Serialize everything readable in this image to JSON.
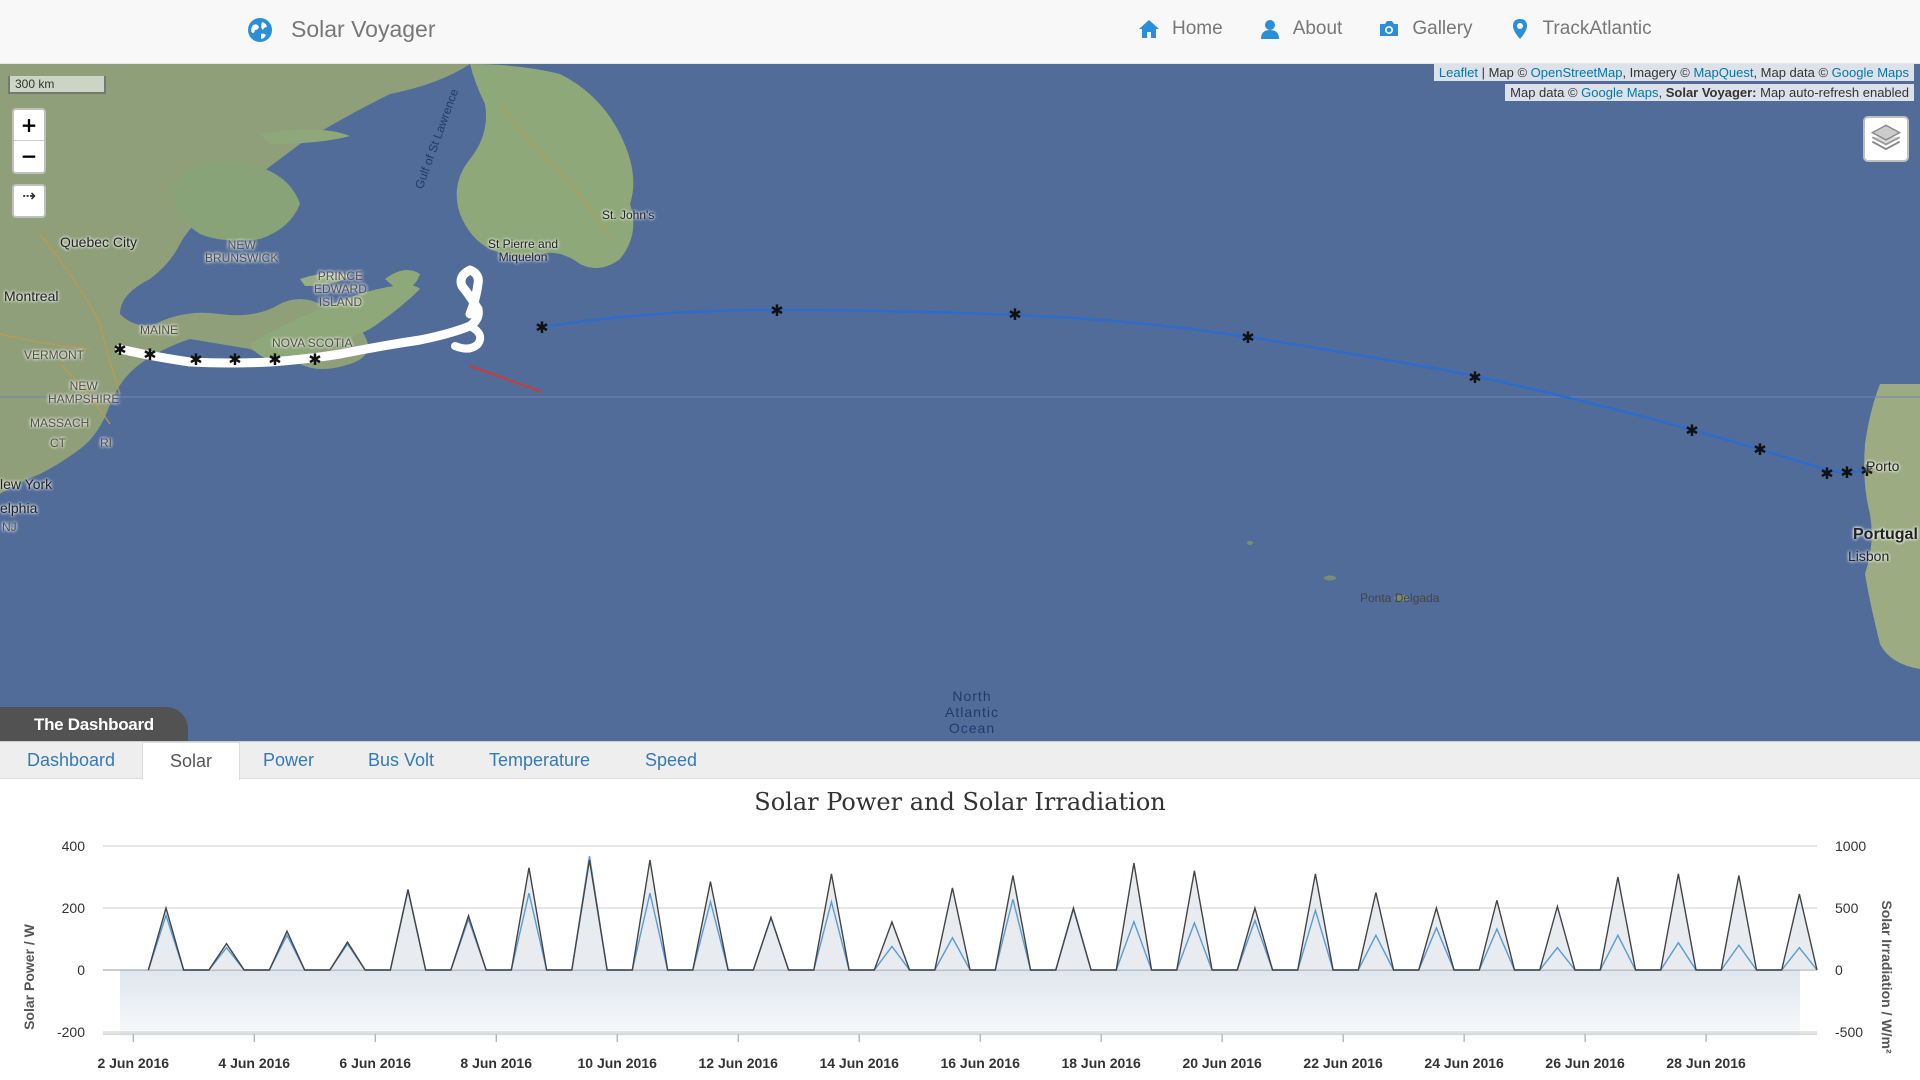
{
  "navbar": {
    "brand": "Solar Voyager",
    "brand_icon": "globe-icon",
    "links": [
      {
        "label": "Home",
        "icon": "home-icon"
      },
      {
        "label": "About",
        "icon": "user-icon"
      },
      {
        "label": "Gallery",
        "icon": "camera-icon"
      },
      {
        "label": "TrackAtlantic",
        "icon": "map-marker-icon"
      }
    ]
  },
  "map": {
    "scale": "300 km",
    "zoom_in": "+",
    "zoom_out": "−",
    "follow": "⇢",
    "attribution1": {
      "leaflet": "Leaflet",
      "sep1": " | Map © ",
      "osm": "OpenStreetMap",
      "sep2": ", Imagery © ",
      "mapquest": "MapQuest",
      "sep3": ", Map data © ",
      "gmaps": "Google Maps"
    },
    "attribution2": {
      "prefix": "Map data © ",
      "gmaps": "Google Maps",
      "sep": ", ",
      "sv": "Solar Voyager:",
      "suffix": " Map auto-refresh enabled"
    },
    "labels": {
      "quebec": "Quebec City",
      "montreal": "Montreal",
      "new_brunswick": "NEW\nBRUNSWICK",
      "pei": "PRINCE\nEDWARD\nISLAND",
      "nova_scotia": "NOVA SCOTIA",
      "maine": "MAINE",
      "vermont": "VERMONT",
      "new_hampshire": "NEW\nHAMPSHIRE",
      "massach": "MASSACH",
      "ct": "CT",
      "ri": "RI",
      "new_york": "lew York",
      "elphia": "elphia",
      "nj": "NJ",
      "st_pierre": "St Pierre and\nMiquelon",
      "st_johns": "St. John's",
      "gulf": "Gulf of St Lawrence",
      "porto": "Porto",
      "portugal": "Portugal",
      "lisbon": "Lisbon",
      "ponta": "Ponta Delgada",
      "ocean": "North\nAtlantic\nOcean"
    }
  },
  "dashboard": {
    "title": "The Dashboard",
    "tabs": [
      "Dashboard",
      "Solar",
      "Power",
      "Bus Volt",
      "Temperature",
      "Speed"
    ],
    "active_tab": "Solar"
  },
  "colors": {
    "power_line": "#444444",
    "irradiance_line": "#5b9bd5",
    "route": "#2d6ccb",
    "ocean": "#516c98"
  },
  "chart_data": {
    "type": "area",
    "title": "Solar Power and Solar Irradiation",
    "ylabel": "Solar Power / W",
    "ylabel_right": "Solar Irradiation / W/m²",
    "ylim": [
      -200,
      400
    ],
    "ylim_right": [
      -500,
      1000
    ],
    "yticks": [
      "400",
      "200",
      "0",
      "-200"
    ],
    "yticks_right": [
      "1000",
      "500",
      "0",
      "-500"
    ],
    "xlim": [
      "2016-06-01T12:00",
      "2016-06-29T20:00"
    ],
    "xticks": [
      "2 Jun 2016",
      "4 Jun 2016",
      "6 Jun 2016",
      "8 Jun 2016",
      "10 Jun 2016",
      "12 Jun 2016",
      "14 Jun 2016",
      "16 Jun 2016",
      "18 Jun 2016",
      "20 Jun 2016",
      "22 Jun 2016",
      "24 Jun 2016",
      "26 Jun 2016",
      "28 Jun 2016"
    ],
    "series": [
      {
        "name": "Solar Power",
        "axis": "left",
        "daily_peak_date": [
          "2016-06-02",
          "2016-06-03",
          "2016-06-04",
          "2016-06-05",
          "2016-06-06",
          "2016-06-07",
          "2016-06-08",
          "2016-06-09",
          "2016-06-10",
          "2016-06-11",
          "2016-06-12",
          "2016-06-13",
          "2016-06-14",
          "2016-06-15",
          "2016-06-16",
          "2016-06-17",
          "2016-06-18",
          "2016-06-19",
          "2016-06-20",
          "2016-06-21",
          "2016-06-22",
          "2016-06-23",
          "2016-06-24",
          "2016-06-25",
          "2016-06-26",
          "2016-06-27",
          "2016-06-28",
          "2016-06-29"
        ],
        "daily_peak_value": [
          200,
          85,
          125,
          90,
          260,
          175,
          330,
          355,
          355,
          285,
          170,
          310,
          155,
          265,
          305,
          200,
          345,
          320,
          200,
          310,
          250,
          200,
          225,
          205,
          300,
          310,
          305,
          245
        ]
      },
      {
        "name": "Solar Irradiation",
        "axis": "right",
        "daily_peak_date": [
          "2016-06-02",
          "2016-06-03",
          "2016-06-04",
          "2016-06-05",
          "2016-06-06",
          "2016-06-07",
          "2016-06-08",
          "2016-06-09",
          "2016-06-10",
          "2016-06-11",
          "2016-06-12",
          "2016-06-13",
          "2016-06-14",
          "2016-06-15",
          "2016-06-16",
          "2016-06-17",
          "2016-06-18",
          "2016-06-19",
          "2016-06-20",
          "2016-06-21",
          "2016-06-22",
          "2016-06-23",
          "2016-06-24",
          "2016-06-25",
          "2016-06-26",
          "2016-06-27",
          "2016-06-28",
          "2016-06-29"
        ],
        "daily_peak_value": [
          440,
          180,
          280,
          210,
          640,
          410,
          620,
          920,
          620,
          550,
          420,
          550,
          190,
          260,
          570,
          490,
          390,
          380,
          400,
          480,
          280,
          340,
          330,
          180,
          280,
          220,
          200,
          180
        ]
      }
    ]
  }
}
